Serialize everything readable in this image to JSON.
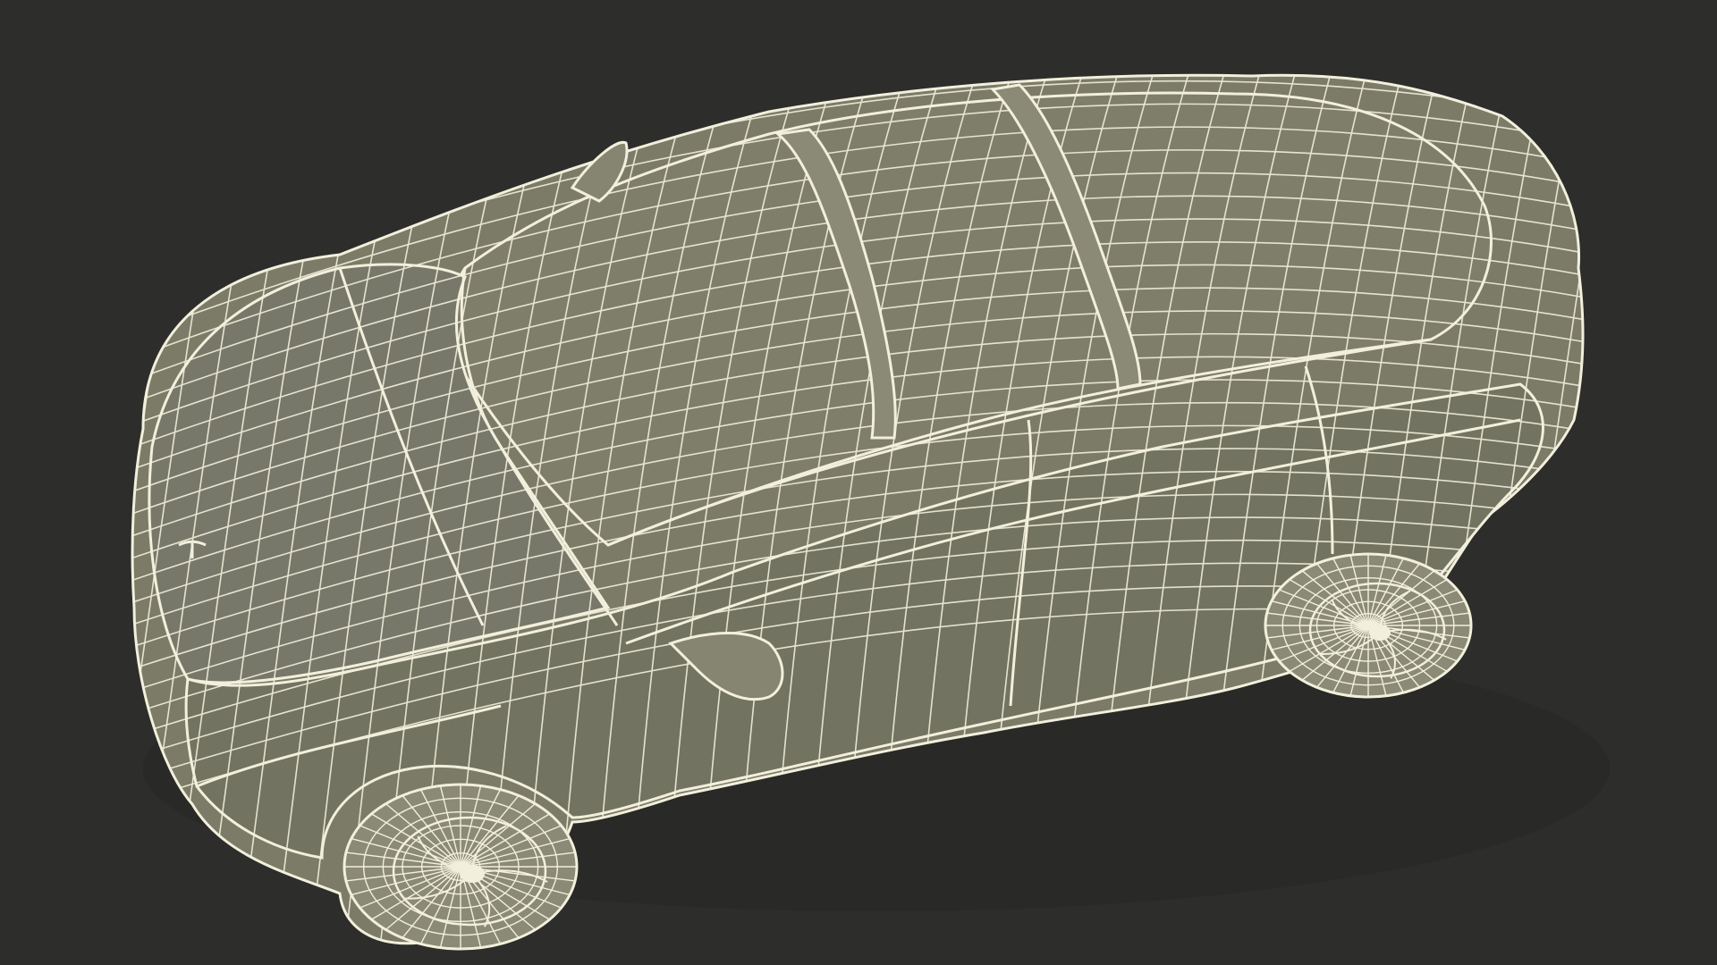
{
  "scene": {
    "subject": "car-wireframe",
    "colors": {
      "background": "#2d2d2b",
      "surface": "#7b7b68",
      "surface_dark": "#6c6c5b",
      "surface_light": "#868672",
      "wire": "#f2f0dc",
      "tire": "#8a8a76",
      "shadow": "#242422"
    }
  }
}
